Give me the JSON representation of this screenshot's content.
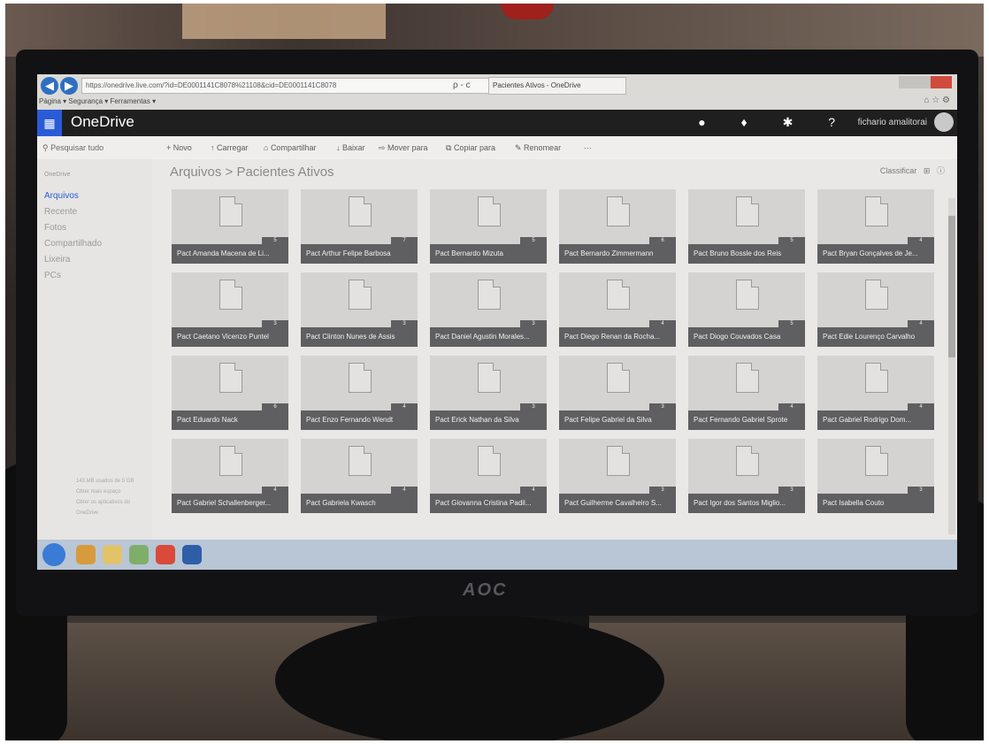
{
  "browser": {
    "url": "https://onedrive.live.com/?id=DE0001141C8078%21108&cid=DE0001141C8078",
    "search_glyph": "ρ - c",
    "tab_title": "Pacientes Ativos - OneDrive",
    "toolbar": "Página ▾  Segurança ▾  Ferramentas ▾"
  },
  "app": {
    "brand": "OneDrive",
    "user": "fichario amalitorai"
  },
  "commands": {
    "search": "Pesquisar tudo",
    "new": "+ Novo",
    "upload": "Carregar",
    "share": "Compartilhar",
    "download": "Baixar",
    "move": "Mover para",
    "copy": "Copiar para",
    "rename": "Renomear",
    "more": "···",
    "sort": "Classificar"
  },
  "sidebar": {
    "heading": "OneDrive",
    "items": [
      "Arquivos",
      "Recente",
      "Fotos",
      "Compartilhado",
      "Lixeira",
      "PCs"
    ],
    "storage": [
      "143 MB usados de 5 GB",
      "Obter mais espaço",
      "Obter os aplicativos do OneDrive"
    ]
  },
  "breadcrumb": {
    "root": "Arquivos",
    "separator": ">",
    "current": "Pacientes Ativos"
  },
  "monitor": {
    "brand": "AOC"
  },
  "folders": [
    {
      "name": "Pact Amanda Macena de Li...",
      "count": "5"
    },
    {
      "name": "Pact Arthur Felipe Barbosa",
      "count": "7"
    },
    {
      "name": "Pact Bernardo Mizuta",
      "count": "5"
    },
    {
      "name": "Pact Bernardo Zimmermann",
      "count": "6"
    },
    {
      "name": "Pact Bruno Bossle dos Reis",
      "count": "5"
    },
    {
      "name": "Pact Bryan Gonçalves de Je...",
      "count": "4"
    },
    {
      "name": "Pact Caetano Vicenzo Puntel",
      "count": "3"
    },
    {
      "name": "Pact Clinton Nunes de Assis",
      "count": "3"
    },
    {
      "name": "Pact Daniel Agustin Morales...",
      "count": "3"
    },
    {
      "name": "Pact Diego Renan da Rocha...",
      "count": "4"
    },
    {
      "name": "Pact Diogo Couvados Casa",
      "count": "5"
    },
    {
      "name": "Pact Edie Lourenço Carvalho",
      "count": "4"
    },
    {
      "name": "Pact Eduardo Nack",
      "count": "6"
    },
    {
      "name": "Pact Enzo Fernando Wendt",
      "count": "4"
    },
    {
      "name": "Pact Erick Nathan da Silva",
      "count": "3"
    },
    {
      "name": "Pact Felipe Gabriel da Silva",
      "count": "3"
    },
    {
      "name": "Pact Fernando Gabriel Sprote",
      "count": "4"
    },
    {
      "name": "Pact Gabriel Rodrigo Dom...",
      "count": "4"
    },
    {
      "name": "Pact Gabriel Schallenberger...",
      "count": "4"
    },
    {
      "name": "Pact Gabriela Kwasch",
      "count": "4"
    },
    {
      "name": "Pact Giovanna Cristina Padil...",
      "count": "4"
    },
    {
      "name": "Pact Guilherme Cavalheiro S...",
      "count": "3"
    },
    {
      "name": "Pact Igor dos Santos Miglio...",
      "count": "3"
    },
    {
      "name": "Pact Isabella Couto",
      "count": "3"
    }
  ]
}
